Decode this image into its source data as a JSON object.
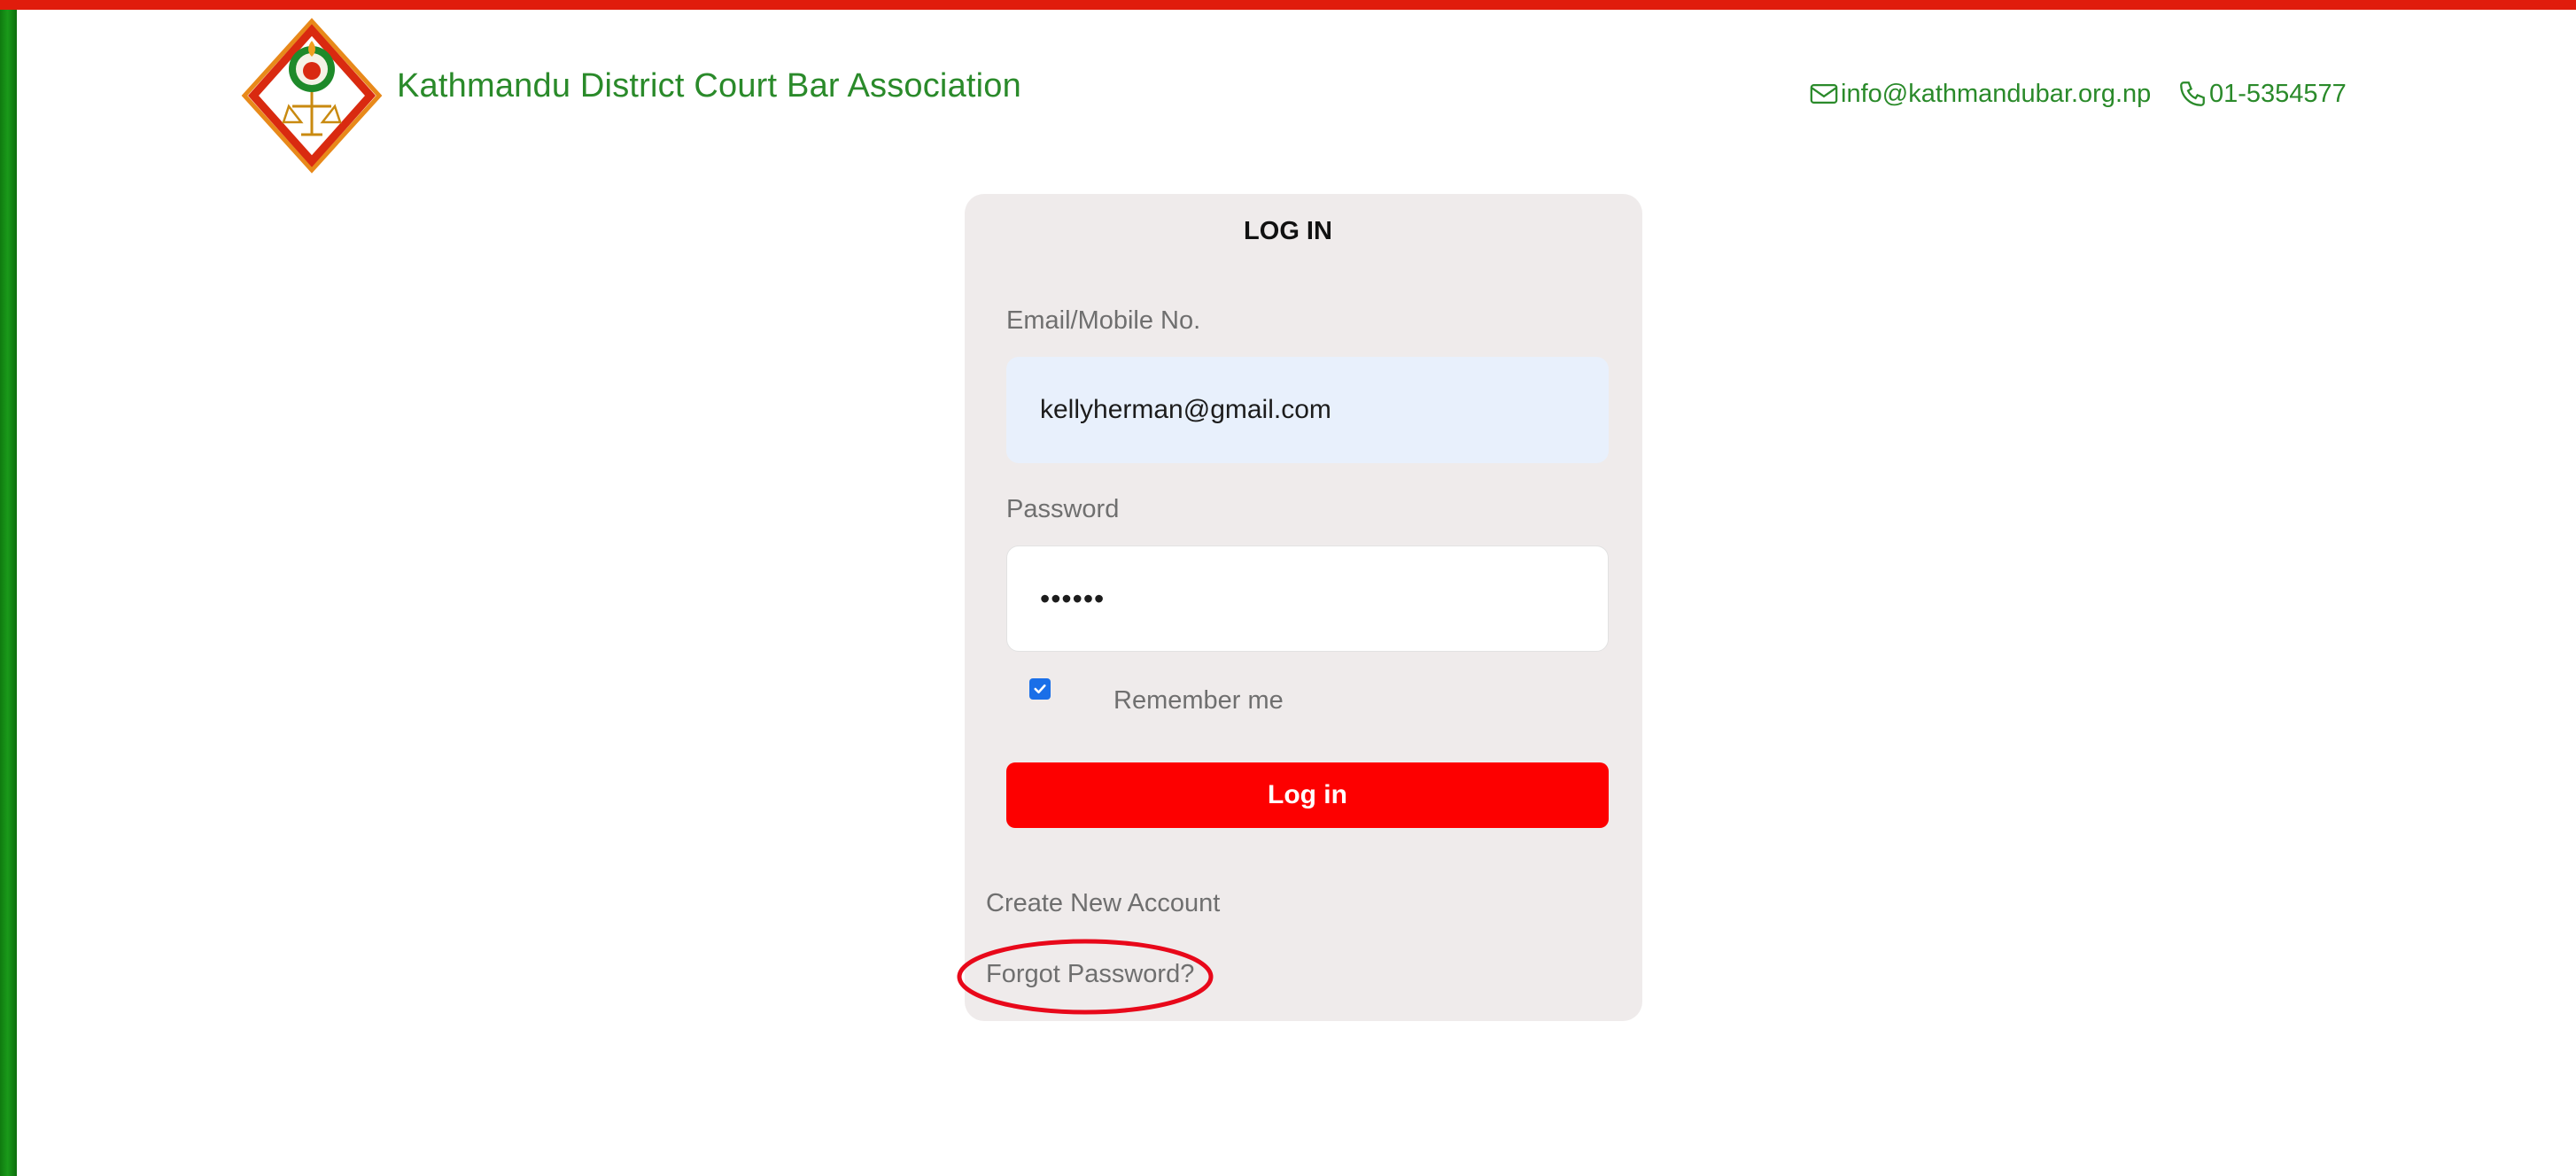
{
  "header": {
    "site_title": "Kathmandu District Court Bar Association",
    "email": "info@kathmandubar.org.np",
    "phone": "01-5354577",
    "email_icon": "envelope-icon",
    "phone_icon": "phone-icon"
  },
  "login_form": {
    "title": "LOG IN",
    "email_label": "Email/Mobile No.",
    "email_value": "kellyherman@gmail.com",
    "password_label": "Password",
    "password_value": "••••••",
    "remember_label": "Remember me",
    "remember_checked": true,
    "submit_label": "Log in",
    "create_account_link": "Create New Account",
    "forgot_password_link": "Forgot Password?"
  },
  "colors": {
    "brand_green": "#2a8a2a",
    "accent_red": "#fd0000",
    "top_bar_red": "#e01c0c",
    "card_background": "#efebeb",
    "autofill_blue": "#e8f0fc"
  }
}
